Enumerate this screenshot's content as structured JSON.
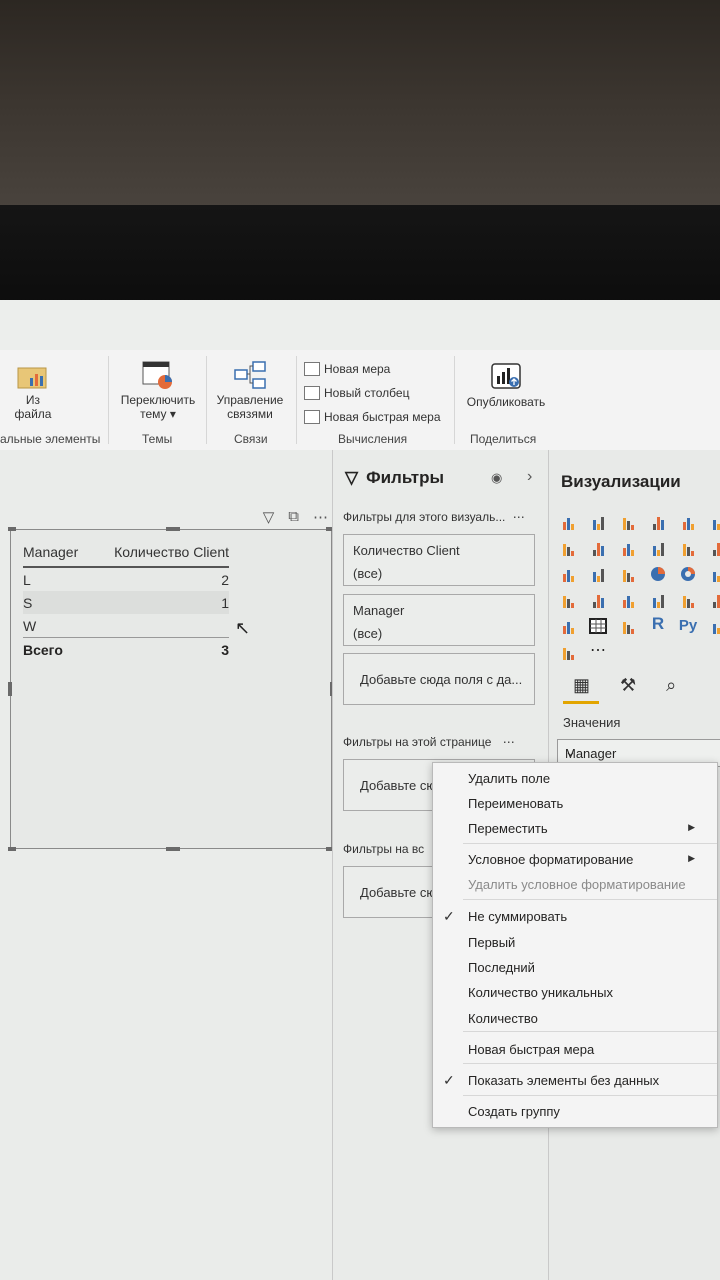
{
  "ribbon": {
    "from_file_label": "Из\nфайла",
    "group_visual_elements": "альные элементы",
    "switch_theme_label": "Переключить\nтему ▾",
    "group_themes": "Темы",
    "manage_relations_label": "Управление\nсвязями",
    "group_relations": "Связи",
    "new_measure": "Новая мера",
    "new_column": "Новый столбец",
    "new_quick_measure": "Новая быстрая мера",
    "group_calculations": "Вычисления",
    "publish_label": "Опубликовать",
    "group_share": "Поделиться"
  },
  "table": {
    "header_manager": "Manager",
    "header_count": "Количество Client",
    "rows": [
      {
        "manager": "L",
        "count": "2"
      },
      {
        "manager": "S",
        "count": "1"
      },
      {
        "manager": "W",
        "count": ""
      }
    ],
    "total_label": "Всего",
    "total_value": "3"
  },
  "filters": {
    "title": "Фильтры",
    "section_visual": "Фильтры для этого визуаль...",
    "card1_title": "Количество Client",
    "card1_value": "(все)",
    "card2_title": "Manager",
    "card2_value": "(все)",
    "add_fields": "Добавьте сюда поля с да...",
    "section_page": "Фильтры на этой странице",
    "add_page": "Добавьте сю",
    "section_all": "Фильтры на вс",
    "add_all": "Добавьте сю"
  },
  "viz": {
    "title": "Визуализации",
    "values_label": "Значения",
    "field_manager": "Manager"
  },
  "menu": {
    "remove_field": "Удалить поле",
    "rename": "Переименовать",
    "move": "Переместить",
    "conditional_formatting": "Условное форматирование",
    "remove_conditional": "Удалить условное форматирование",
    "dont_summarize": "Не суммировать",
    "first": "Первый",
    "last": "Последний",
    "count_distinct": "Количество уникальных",
    "count": "Количество",
    "new_quick_measure": "Новая быстрая мера",
    "show_items_no_data": "Показать элементы без данных",
    "create_group": "Создать группу"
  }
}
